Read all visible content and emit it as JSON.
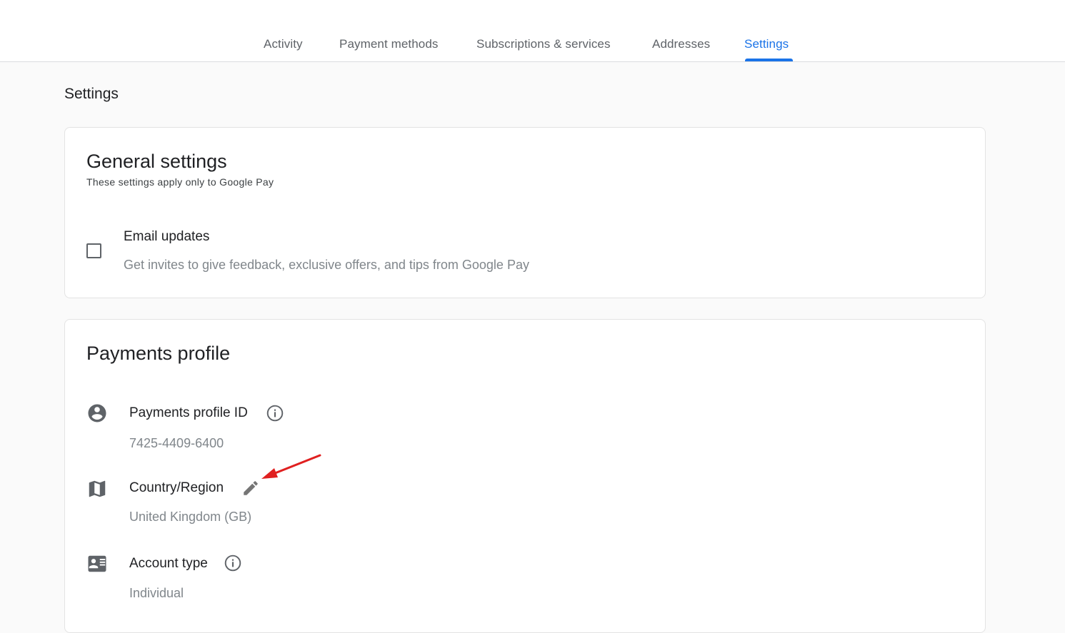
{
  "tabs": [
    {
      "label": "Activity"
    },
    {
      "label": "Payment methods"
    },
    {
      "label": "Subscriptions & services"
    },
    {
      "label": "Addresses"
    },
    {
      "label": "Settings"
    }
  ],
  "page_title": "Settings",
  "general": {
    "title": "General settings",
    "subtitle": "These settings apply only to Google Pay",
    "email": {
      "title": "Email updates",
      "description": "Get invites to give feedback, exclusive offers, and tips from Google Pay",
      "checked": false
    }
  },
  "payments": {
    "title": "Payments profile",
    "profile_id": {
      "label": "Payments profile ID",
      "value": "7425-4409-6400",
      "icon": "account-circle-icon"
    },
    "country": {
      "label": "Country/Region",
      "value": "United Kingdom (GB)",
      "icon": "map-icon"
    },
    "account_type": {
      "label": "Account type",
      "value": "Individual",
      "icon": "id-card-icon"
    }
  },
  "colors": {
    "accent": "#1a73e8",
    "annotation_arrow": "#e02020"
  }
}
